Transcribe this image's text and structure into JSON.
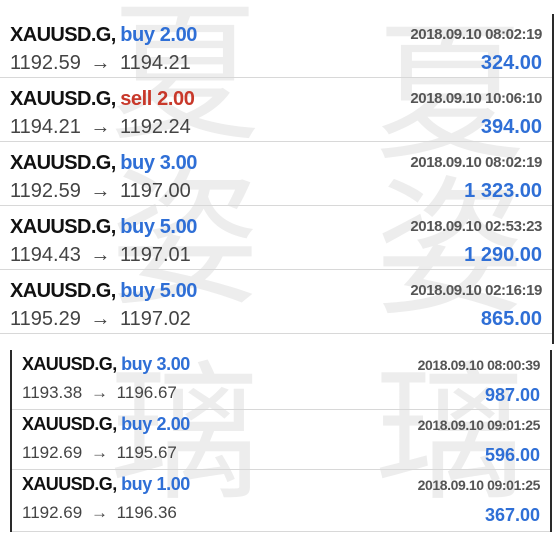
{
  "watermark": {
    "glyph_1": "夏",
    "glyph_2": "姿",
    "glyph_3": "璃"
  },
  "colors": {
    "buy": "#2f6fd6",
    "sell": "#c8382a",
    "profit": "#2f6fd6",
    "symbol": "#111111",
    "price": "#444444",
    "timestamp": "#555555"
  },
  "arrow_icon": "right-arrow-icon",
  "panels": [
    {
      "trades": [
        {
          "symbol": "XAUUSD.G,",
          "type": "buy",
          "lots": "2.00",
          "time": "2018.09.10 08:02:19",
          "open": "1192.59",
          "arrow": "→",
          "close": "1194.21",
          "profit": "324.00"
        },
        {
          "symbol": "XAUUSD.G,",
          "type": "sell",
          "lots": "2.00",
          "time": "2018.09.10 10:06:10",
          "open": "1194.21",
          "arrow": "→",
          "close": "1192.24",
          "profit": "394.00"
        },
        {
          "symbol": "XAUUSD.G,",
          "type": "buy",
          "lots": "3.00",
          "time": "2018.09.10 08:02:19",
          "open": "1192.59",
          "arrow": "→",
          "close": "1197.00",
          "profit": "1 323.00"
        },
        {
          "symbol": "XAUUSD.G,",
          "type": "buy",
          "lots": "5.00",
          "time": "2018.09.10 02:53:23",
          "open": "1194.43",
          "arrow": "→",
          "close": "1197.01",
          "profit": "1 290.00"
        },
        {
          "symbol": "XAUUSD.G,",
          "type": "buy",
          "lots": "5.00",
          "time": "2018.09.10 02:16:19",
          "open": "1195.29",
          "arrow": "→",
          "close": "1197.02",
          "profit": "865.00"
        }
      ]
    },
    {
      "trades": [
        {
          "symbol": "XAUUSD.G,",
          "type": "buy",
          "lots": "3.00",
          "time": "2018.09.10 08:00:39",
          "open": "1193.38",
          "arrow": "→",
          "close": "1196.67",
          "profit": "987.00"
        },
        {
          "symbol": "XAUUSD.G,",
          "type": "buy",
          "lots": "2.00",
          "time": "2018.09.10 09:01:25",
          "open": "1192.69",
          "arrow": "→",
          "close": "1195.67",
          "profit": "596.00"
        },
        {
          "symbol": "XAUUSD.G,",
          "type": "buy",
          "lots": "1.00",
          "time": "2018.09.10 09:01:25",
          "open": "1192.69",
          "arrow": "→",
          "close": "1196.36",
          "profit": "367.00"
        }
      ]
    }
  ]
}
